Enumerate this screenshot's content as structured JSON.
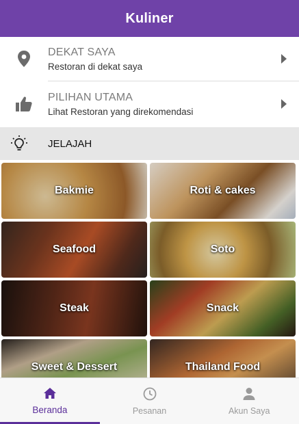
{
  "app_bar": {
    "title": "Kuliner"
  },
  "menu": [
    {
      "title": "DEKAT SAYA",
      "subtitle": "Restoran di dekat saya",
      "icon": "location-pin-icon"
    },
    {
      "title": "PILIHAN UTAMA",
      "subtitle": "Lihat Restoran yang direkomendasi",
      "icon": "thumbs-up-icon"
    }
  ],
  "section": {
    "label": "JELAJAH",
    "icon": "lightbulb-icon"
  },
  "categories": [
    {
      "name": "Bakmie"
    },
    {
      "name": "Roti & cakes"
    },
    {
      "name": "Seafood"
    },
    {
      "name": "Soto"
    },
    {
      "name": "Steak"
    },
    {
      "name": "Snack"
    },
    {
      "name": "Sweet & Dessert"
    },
    {
      "name": "Thailand Food"
    }
  ],
  "bottom_nav": {
    "items": [
      {
        "label": "Beranda",
        "icon": "home-icon",
        "active": true
      },
      {
        "label": "Pesanan",
        "icon": "clock-icon",
        "active": false
      },
      {
        "label": "Akun Saya",
        "icon": "person-icon",
        "active": false
      }
    ]
  },
  "colors": {
    "primary": "#6f42a8",
    "active_nav": "#5b2f9a"
  }
}
